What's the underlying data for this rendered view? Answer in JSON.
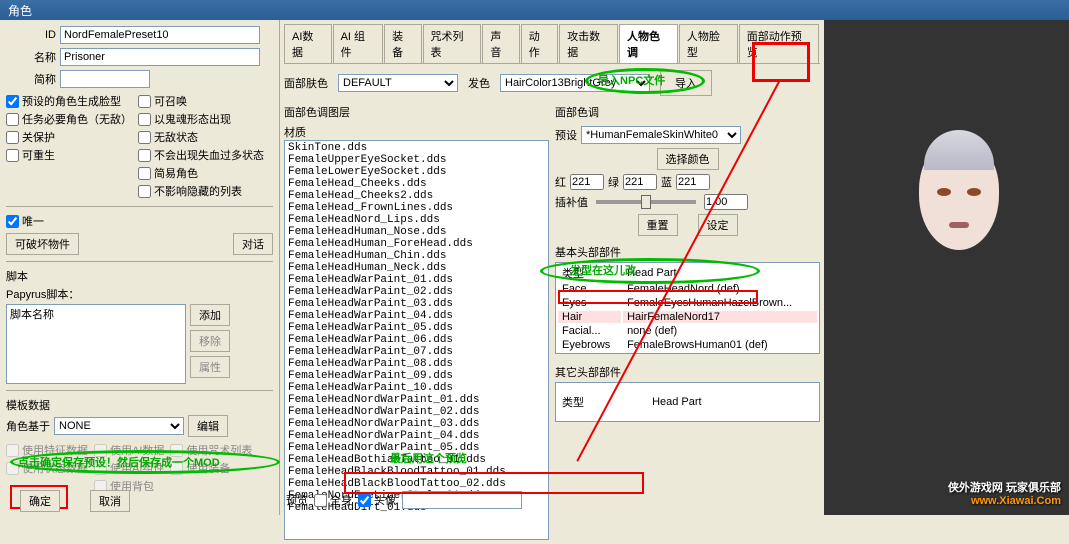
{
  "window_title": "角色",
  "left": {
    "id_label": "ID",
    "id_value": "NordFemalePreset10",
    "name_label": "名称",
    "name_value": "Prisoner",
    "short_label": "简称",
    "short_value": "",
    "checks_col1": [
      "预设的角色生成脸型",
      "任务必要角色（无敌）",
      "关保护",
      "可重生"
    ],
    "checks_col2": [
      "可召唤",
      "以鬼魂形态出现",
      "无敌状态",
      "不会出现失血过多状态",
      "简易角色",
      "不影响隐藏的列表"
    ],
    "unique": "唯一",
    "btn_destructible": "可破坏物件",
    "btn_dialog": "对话",
    "script_group": "脚本",
    "papyrus": "Papyrus脚本：",
    "script_name": "脚本名称",
    "btn_add": "添加",
    "btn_remove": "移除",
    "btn_props": "属性",
    "template_group": "模板数据",
    "role_base": "角色基于",
    "role_base_value": "NONE",
    "btn_edit": "编辑",
    "template_checks": [
      "使用特征数据",
      "使用AI数据",
      "使用咒术列表",
      "使用状态数据",
      "使用AI组件",
      "使用装备",
      "使用背包"
    ],
    "annot_confirm": "点击确定保存预设！然后保存成一个MOD",
    "btn_ok": "确定",
    "btn_cancel": "取消"
  },
  "tabs": [
    "AI数据",
    "AI 组件",
    "装备",
    "咒术列表",
    "声音",
    "动作",
    "攻击数据",
    "人物色调",
    "人物脸型",
    "面部动作预览"
  ],
  "active_tab": "人物色调",
  "center": {
    "face_skin_label": "面部肤色",
    "face_skin_value": "DEFAULT",
    "hair_color_label": "发色",
    "hair_color_value": "HairColor13BrightGrey",
    "btn_import": "导入",
    "annot_import": "导入NPC文件",
    "layer_group": "面部色调图层",
    "material": "材质",
    "materials": [
      "SkinTone.dds",
      "FemaleUpperEyeSocket.dds",
      "FemaleLowerEyeSocket.dds",
      "FemaleHead_Cheeks.dds",
      "FemaleHead_Cheeks2.dds",
      "FemaleHead_FrownLines.dds",
      "FemaleHeadNord_Lips.dds",
      "FemaleHeadHuman_Nose.dds",
      "FemaleHeadHuman_ForeHead.dds",
      "FemaleHeadHuman_Chin.dds",
      "FemaleHeadHuman_Neck.dds",
      "FemaleHeadWarPaint_01.dds",
      "FemaleHeadWarPaint_02.dds",
      "FemaleHeadWarPaint_03.dds",
      "FemaleHeadWarPaint_04.dds",
      "FemaleHeadWarPaint_05.dds",
      "FemaleHeadWarPaint_06.dds",
      "FemaleHeadWarPaint_07.dds",
      "FemaleHeadWarPaint_08.dds",
      "FemaleHeadWarPaint_09.dds",
      "FemaleHeadWarPaint_10.dds",
      "FemaleHeadNordWarPaint_01.dds",
      "FemaleHeadNordWarPaint_02.dds",
      "FemaleHeadNordWarPaint_03.dds",
      "FemaleHeadNordWarPaint_04.dds",
      "FemaleHeadNordWarPaint_05.dds",
      "FemaleHeadBothiahTattoo_01.dds",
      "FemaleHeadBlackBloodTattoo_01.dds",
      "FemaleHeadBlackBloodTattoo_02.dds",
      "FemaleNordEyeLinerStyle_01.dds",
      "FemaleHeadDirt_01.dds"
    ],
    "annot_preview": "最后用这个预览",
    "preview_label": "预览",
    "fullbody": "全身",
    "headshot": "头像"
  },
  "right_sub": {
    "tone_group": "面部色调",
    "preset_label": "预设",
    "preset_value": "*HumanFemaleSkinWhite0",
    "btn_choose_color": "选择颜色",
    "red": "红",
    "r_val": "221",
    "green": "绿",
    "g_val": "221",
    "blue": "蓝",
    "b_val": "221",
    "interp_label": "插补值",
    "interp_val": "1.00",
    "btn_reset": "重置",
    "btn_set": "设定",
    "base_parts": "基本头部部件",
    "col_type": "类型",
    "col_part": "Head Part",
    "annot_hair": "发型在这儿改",
    "rows": [
      {
        "k": "Face",
        "v": "FemaleHeadNord (def)"
      },
      {
        "k": "Eyes",
        "v": "FemaleEyesHumanHazelBrown..."
      },
      {
        "k": "Hair",
        "v": "HairFemaleNord17"
      },
      {
        "k": "Facial...",
        "v": "none (def)"
      },
      {
        "k": "Eyebrows",
        "v": "FemaleBrowsHuman01 (def)"
      }
    ],
    "other_parts": "其它头部部件",
    "other_col": "Head Part"
  },
  "watermark_cn": "侠外游戏网        玩家俱乐部",
  "watermark_url": "www.Xiawai.Com"
}
